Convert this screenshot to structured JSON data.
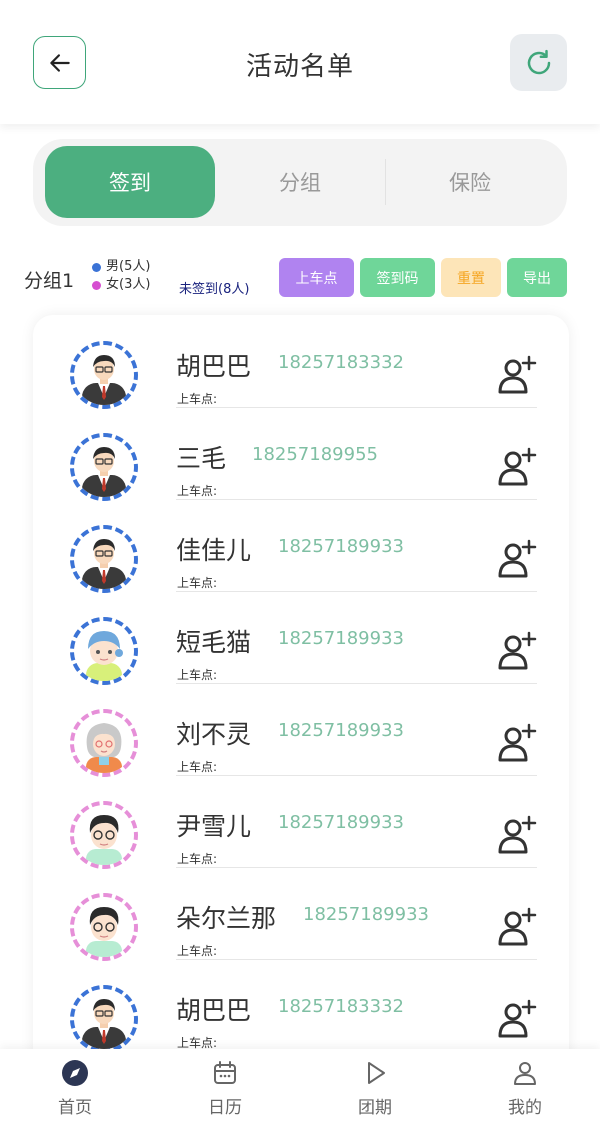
{
  "header": {
    "title": "活动名单",
    "back_icon": "arrow-left-icon",
    "refresh_icon": "refresh-icon"
  },
  "tabs": [
    {
      "label": "签到",
      "active": true
    },
    {
      "label": "分组",
      "active": false
    },
    {
      "label": "保险",
      "active": false
    }
  ],
  "group": {
    "name": "分组1",
    "male": "男(5人)",
    "female": "女(3人)",
    "male_color": "#3b73d6",
    "female_color": "#d64fd1",
    "unsigned": "未签到(8人)"
  },
  "actions": {
    "board": "上车点",
    "code": "签到码",
    "reset": "重置",
    "export": "导出"
  },
  "members": [
    {
      "name": "胡巴巴",
      "phone": "18257183332",
      "board_label": "上车点:",
      "gender": "male",
      "avatar": "boy-suit"
    },
    {
      "name": "三毛",
      "phone": "18257189955",
      "board_label": "上车点:",
      "gender": "male",
      "avatar": "boy-suit"
    },
    {
      "name": "佳佳儿",
      "phone": "18257189933",
      "board_label": "上车点:",
      "gender": "male",
      "avatar": "boy-suit"
    },
    {
      "name": "短毛猫",
      "phone": "18257189933",
      "board_label": "上车点:",
      "gender": "male",
      "avatar": "kid-blue-hat"
    },
    {
      "name": "刘不灵",
      "phone": "18257189933",
      "board_label": "上车点:",
      "gender": "female",
      "avatar": "grandma"
    },
    {
      "name": "尹雪儿",
      "phone": "18257189933",
      "board_label": "上车点:",
      "gender": "female",
      "avatar": "boy-glasses"
    },
    {
      "name": "朵尔兰那",
      "phone": "18257189933",
      "board_label": "上车点:",
      "gender": "female",
      "avatar": "boy-glasses"
    },
    {
      "name": "胡巴巴",
      "phone": "18257183332",
      "board_label": "上车点:",
      "gender": "male",
      "avatar": "boy-suit"
    }
  ],
  "nav": [
    {
      "label": "首页",
      "icon": "compass-icon",
      "active": true
    },
    {
      "label": "日历",
      "icon": "calendar-icon",
      "active": false
    },
    {
      "label": "团期",
      "icon": "play-icon",
      "active": false
    },
    {
      "label": "我的",
      "icon": "user-icon",
      "active": false
    }
  ],
  "colors": {
    "primary": "#4caf80",
    "phone": "#7fbfa3",
    "board_btn": "#b083f0",
    "reset_btn": "#fde5b8"
  }
}
